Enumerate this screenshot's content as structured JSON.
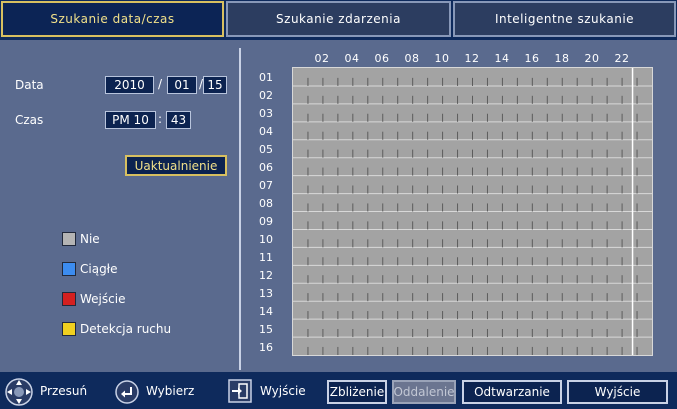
{
  "tabs": [
    {
      "label": "Szukanie data/czas",
      "active": true
    },
    {
      "label": "Szukanie zdarzenia",
      "active": false
    },
    {
      "label": "Inteligentne szukanie",
      "active": false
    }
  ],
  "date": {
    "label": "Data",
    "year": "2010",
    "month": "01",
    "day": "15",
    "sep": "/"
  },
  "time": {
    "label": "Czas",
    "hour": "PM 10",
    "minute": "43",
    "sep": ":"
  },
  "update_button": "Uaktualnienie",
  "legend": [
    {
      "label": "Nie",
      "color": "#b4b4b4"
    },
    {
      "label": "Ciągłe",
      "color": "#3c8cf0"
    },
    {
      "label": "Wejście",
      "color": "#d42020"
    },
    {
      "label": "Detekcja ruchu",
      "color": "#f0d020"
    }
  ],
  "timeline": {
    "hour_labels": [
      "02",
      "04",
      "06",
      "08",
      "10",
      "12",
      "14",
      "16",
      "18",
      "20",
      "22"
    ],
    "day_labels": [
      "01",
      "02",
      "03",
      "04",
      "05",
      "06",
      "07",
      "08",
      "09",
      "10",
      "11",
      "12",
      "13",
      "14",
      "15",
      "16"
    ],
    "cell_color": "#a3a3a3",
    "current_time_hour": 22.7
  },
  "footer": {
    "move": "Przesuń",
    "select": "Wybierz",
    "exit_hint": "Wyjście",
    "zoom_in": "Zbliżenie",
    "zoom_out": "Oddalenie",
    "play": "Odtwarzanie",
    "exit": "Wyjście"
  }
}
